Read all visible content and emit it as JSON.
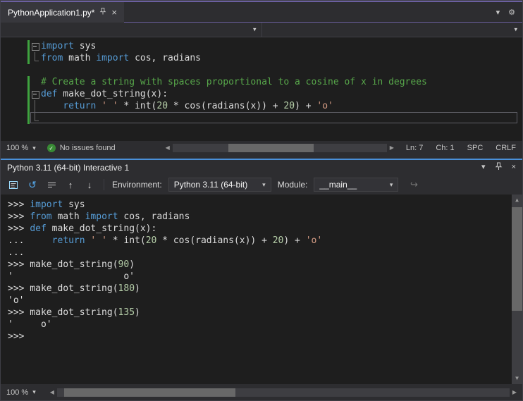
{
  "colors": {
    "accentPurple": "#6b5fa0",
    "accentBlue": "#4a90d9",
    "keyword": "#569cd6",
    "plain": "#dcdcdc",
    "comment": "#57a64a",
    "string": "#d69d85",
    "number": "#b5cea8",
    "changeBar": "#3fa33f",
    "healthGreen": "#388a34"
  },
  "icons": {
    "close": "×",
    "chevron_down": "▾",
    "gear": "⚙",
    "check": "✓",
    "scroll_left": "◀",
    "scroll_right": "▶",
    "scroll_up": "▲",
    "scroll_down": "▼",
    "reset": "↺",
    "history_up": "↑",
    "history_down": "↓",
    "redo": "↪"
  },
  "editor_pane": {
    "tab": {
      "title": "PythonApplication1.py*"
    },
    "lines": [
      {
        "fold": "minus",
        "changed": true,
        "tokens": [
          [
            "k",
            "import"
          ],
          [
            "p",
            " sys"
          ]
        ]
      },
      {
        "fold": "end",
        "changed": true,
        "tokens": [
          [
            "k",
            "from"
          ],
          [
            "p",
            " math "
          ],
          [
            "k",
            "import"
          ],
          [
            "p",
            " cos, radians"
          ]
        ]
      },
      {
        "fold": "",
        "changed": false,
        "tokens": []
      },
      {
        "fold": "",
        "changed": true,
        "tokens": [
          [
            "c",
            "# Create a string with spaces proportional to a cosine of x in degrees"
          ]
        ]
      },
      {
        "fold": "minus",
        "changed": true,
        "tokens": [
          [
            "k",
            "def"
          ],
          [
            "p",
            " make_dot_string(x):"
          ]
        ]
      },
      {
        "fold": "line",
        "changed": true,
        "tokens": [
          [
            "p",
            "    "
          ],
          [
            "k",
            "return"
          ],
          [
            "p",
            " "
          ],
          [
            "s",
            "' '"
          ],
          [
            "p",
            " * int("
          ],
          [
            "n",
            "20"
          ],
          [
            "p",
            " * cos(radians(x)) + "
          ],
          [
            "n",
            "20"
          ],
          [
            "p",
            ") + "
          ],
          [
            "s",
            "'o'"
          ]
        ]
      },
      {
        "fold": "end",
        "changed": true,
        "current": true,
        "tokens": []
      }
    ],
    "status": {
      "zoom": "100 %",
      "health": "No issues found",
      "ln": "Ln: 7",
      "ch": "Ch: 1",
      "spc": "SPC",
      "eol": "CRLF"
    }
  },
  "interactive_pane": {
    "title": "Python 3.11 (64-bit) Interactive 1",
    "toolbar": {
      "environment_label": "Environment:",
      "environment_value": "Python 3.11 (64-bit)",
      "module_label": "Module:",
      "module_value": "__main__"
    },
    "lines": [
      {
        "tokens": [
          [
            "p",
            ">>> "
          ],
          [
            "k",
            "import"
          ],
          [
            "p",
            " sys"
          ]
        ]
      },
      {
        "tokens": [
          [
            "p",
            ">>> "
          ],
          [
            "k",
            "from"
          ],
          [
            "p",
            " math "
          ],
          [
            "k",
            "import"
          ],
          [
            "p",
            " cos, radians"
          ]
        ]
      },
      {
        "tokens": [
          [
            "p",
            ">>> "
          ],
          [
            "k",
            "def"
          ],
          [
            "p",
            " make_dot_string(x):"
          ]
        ]
      },
      {
        "tokens": [
          [
            "p",
            "...     "
          ],
          [
            "k",
            "return"
          ],
          [
            "p",
            " "
          ],
          [
            "s",
            "' '"
          ],
          [
            "p",
            " * int("
          ],
          [
            "n",
            "20"
          ],
          [
            "p",
            " * cos(radians(x)) + "
          ],
          [
            "n",
            "20"
          ],
          [
            "p",
            ") + "
          ],
          [
            "s",
            "'o'"
          ]
        ]
      },
      {
        "tokens": [
          [
            "p",
            "..."
          ]
        ]
      },
      {
        "tokens": [
          [
            "p",
            ">>> make_dot_string("
          ],
          [
            "n",
            "90"
          ],
          [
            "p",
            ")"
          ]
        ]
      },
      {
        "tokens": [
          [
            "p",
            "'                    o'"
          ]
        ]
      },
      {
        "tokens": [
          [
            "p",
            ">>> make_dot_string("
          ],
          [
            "n",
            "180"
          ],
          [
            "p",
            ")"
          ]
        ]
      },
      {
        "tokens": [
          [
            "p",
            "'o'"
          ]
        ]
      },
      {
        "tokens": [
          [
            "p",
            ">>> make_dot_string("
          ],
          [
            "n",
            "135"
          ],
          [
            "p",
            ")"
          ]
        ]
      },
      {
        "tokens": [
          [
            "p",
            "'     o'"
          ]
        ]
      },
      {
        "tokens": [
          [
            "p",
            ">>> "
          ]
        ]
      }
    ],
    "status": {
      "zoom": "100 %"
    }
  }
}
